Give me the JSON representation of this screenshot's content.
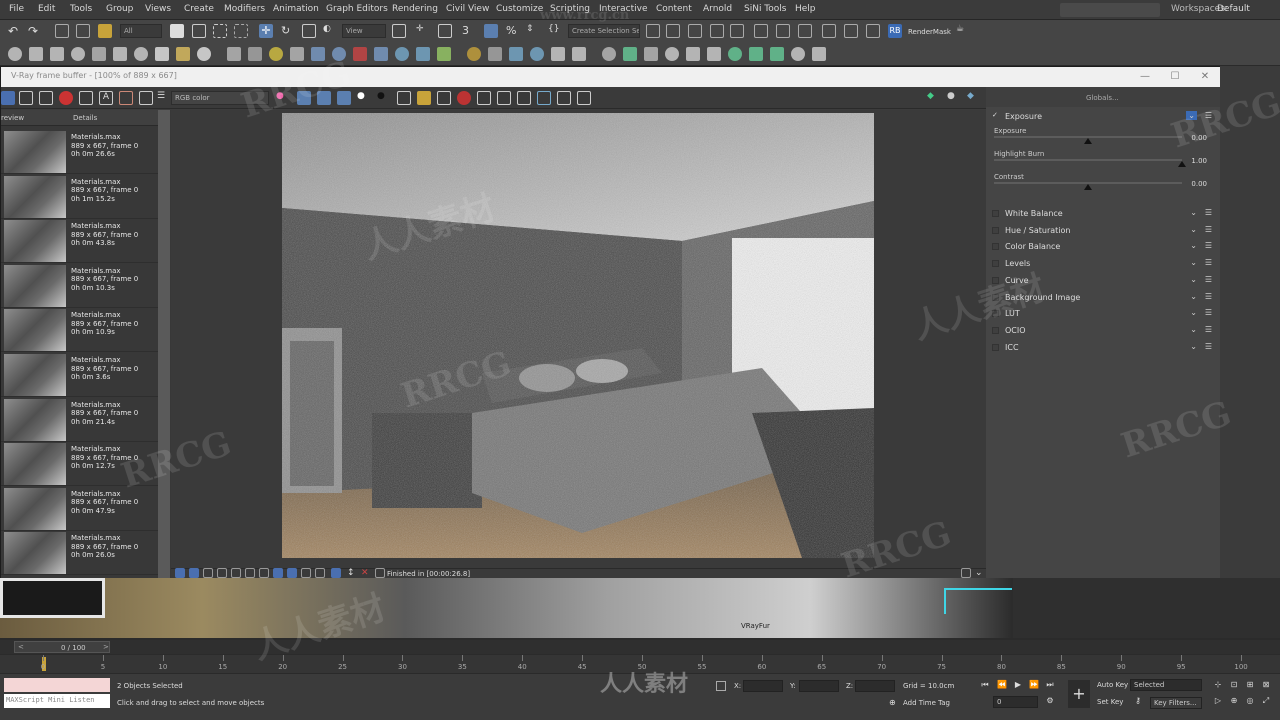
{
  "menubar": {
    "items": [
      "File",
      "Edit",
      "Tools",
      "Group",
      "Views",
      "Create",
      "Modifiers",
      "Animation",
      "Graph Editors",
      "Rendering",
      "Civil View",
      "Customize",
      "Scripting",
      "Interactive",
      "Content",
      "Arnold",
      "SiNi Tools",
      "Help"
    ],
    "workspaces_label": "Workspaces:",
    "workspaces_value": "Default"
  },
  "toolbar": {
    "filter_dropdown": "All",
    "view_dropdown": "View",
    "selection_set": "Create Selection Se",
    "rendermask_label": "RenderMask"
  },
  "framebuffer": {
    "title": "V-Ray frame buffer - [100% of 889 x 667]",
    "channel": "RGB color",
    "status": "Finished in [00:00:26.8]",
    "history_columns": [
      "review",
      "Details"
    ],
    "history": [
      {
        "name": "Materials.max",
        "res": "889 x 667, frame 0",
        "time": "0h 0m 26.6s"
      },
      {
        "name": "Materials.max",
        "res": "889 x 667, frame 0",
        "time": "0h 1m 15.2s"
      },
      {
        "name": "Materials.max",
        "res": "889 x 667, frame 0",
        "time": "0h 0m 43.8s"
      },
      {
        "name": "Materials.max",
        "res": "889 x 667, frame 0",
        "time": "0h 0m 10.3s"
      },
      {
        "name": "Materials.max",
        "res": "889 x 667, frame 0",
        "time": "0h 0m 10.9s"
      },
      {
        "name": "Materials.max",
        "res": "889 x 667, frame 0",
        "time": "0h 0m 3.6s"
      },
      {
        "name": "Materials.max",
        "res": "889 x 667, frame 0",
        "time": "0h 0m 21.4s"
      },
      {
        "name": "Materials.max",
        "res": "889 x 667, frame 0",
        "time": "0h 0m 12.7s"
      },
      {
        "name": "Materials.max",
        "res": "889 x 667, frame 0",
        "time": "0h 0m 47.9s"
      },
      {
        "name": "Materials.max",
        "res": "889 x 667, frame 0",
        "time": "0h 0m 26.0s"
      }
    ]
  },
  "corrections": {
    "globals_label": "Globals...",
    "exposure": {
      "title": "Exposure",
      "sliders": [
        {
          "label": "Exposure",
          "value": "0.00",
          "fraction": 0.5
        },
        {
          "label": "Highlight Burn",
          "value": "1.00",
          "fraction": 1.0
        },
        {
          "label": "Contrast",
          "value": "0.00",
          "fraction": 0.5
        }
      ]
    },
    "layers": [
      "White Balance",
      "Hue / Saturation",
      "Color Balance",
      "Levels",
      "Curve",
      "Background Image",
      "LUT",
      "OCIO",
      "ICC"
    ]
  },
  "viewport": {
    "label": "VRayFur"
  },
  "timeline": {
    "frame_counter": "0 / 100",
    "ticks": [
      "0",
      "5",
      "10",
      "15",
      "20",
      "25",
      "30",
      "35",
      "40",
      "45",
      "50",
      "55",
      "60",
      "65",
      "70",
      "75",
      "80",
      "85",
      "90",
      "95",
      "100"
    ]
  },
  "status": {
    "maxscript": "MAXScript Mini Listen",
    "selection": "2 Objects Selected",
    "prompt": "Click and drag to select and move objects",
    "x_label": "X:",
    "y_label": "Y:",
    "z_label": "Z:",
    "grid": "Grid = 10.0cm",
    "add_time_tag": "Add Time Tag",
    "auto_key": "Auto Key",
    "set_key": "Set Key",
    "selected_dd": "Selected",
    "key_filters": "Key Filters...",
    "frame_value": "0"
  },
  "watermark": {
    "text1": "RRCG",
    "text2": "人人素材",
    "url": "www.rrcg.cn"
  }
}
